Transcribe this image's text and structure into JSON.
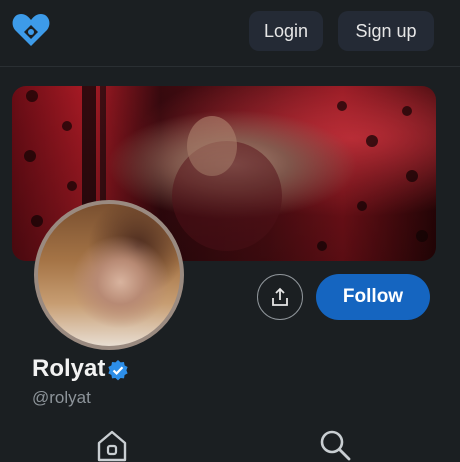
{
  "header": {
    "logo_icon": "heart-logo-icon",
    "login_label": "Login",
    "signup_label": "Sign up"
  },
  "profile": {
    "name": "Rolyat",
    "handle": "@rolyat",
    "verified_icon": "verified-check-icon",
    "share_icon": "share-icon",
    "follow_label": "Follow"
  },
  "bottom_nav": {
    "icons": [
      "home-icon",
      "search-icon"
    ]
  },
  "colors": {
    "accent": "#1565c0",
    "logo": "#3d9be9",
    "background": "#1b1f22"
  }
}
